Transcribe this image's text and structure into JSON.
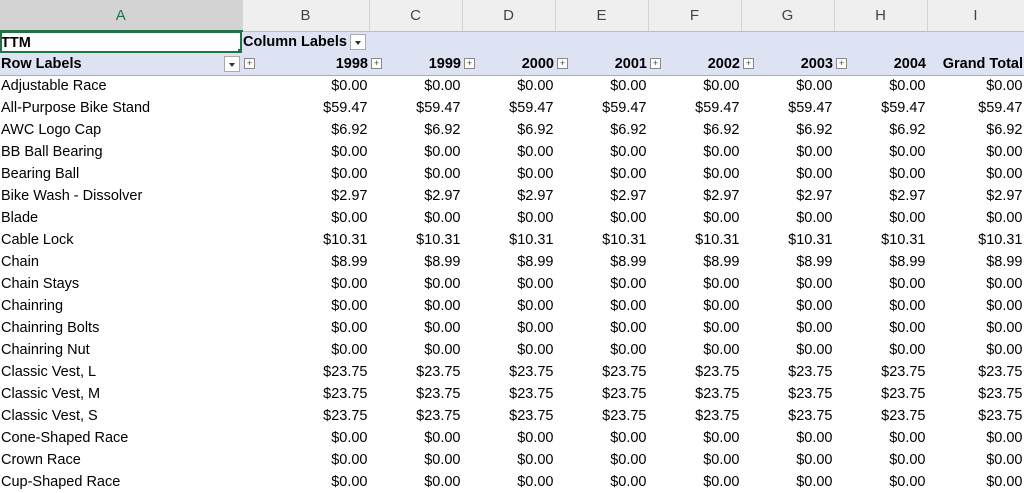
{
  "sheet": {
    "columns": [
      "A",
      "B",
      "C",
      "D",
      "E",
      "F",
      "G",
      "H",
      "I"
    ],
    "pivot": {
      "filter_label": "TTM",
      "column_labels": "Column Labels",
      "row_labels": "Row Labels",
      "years": [
        "1998",
        "1999",
        "2000",
        "2001",
        "2002",
        "2003",
        "2004"
      ],
      "grand_total": "Grand Total"
    },
    "rows": [
      {
        "label": "Adjustable Race",
        "values": [
          "$0.00",
          "$0.00",
          "$0.00",
          "$0.00",
          "$0.00",
          "$0.00",
          "$0.00",
          "$0.00"
        ]
      },
      {
        "label": "All-Purpose Bike Stand",
        "values": [
          "$59.47",
          "$59.47",
          "$59.47",
          "$59.47",
          "$59.47",
          "$59.47",
          "$59.47",
          "$59.47"
        ]
      },
      {
        "label": "AWC Logo Cap",
        "values": [
          "$6.92",
          "$6.92",
          "$6.92",
          "$6.92",
          "$6.92",
          "$6.92",
          "$6.92",
          "$6.92"
        ]
      },
      {
        "label": "BB Ball Bearing",
        "values": [
          "$0.00",
          "$0.00",
          "$0.00",
          "$0.00",
          "$0.00",
          "$0.00",
          "$0.00",
          "$0.00"
        ]
      },
      {
        "label": "Bearing Ball",
        "values": [
          "$0.00",
          "$0.00",
          "$0.00",
          "$0.00",
          "$0.00",
          "$0.00",
          "$0.00",
          "$0.00"
        ]
      },
      {
        "label": "Bike Wash - Dissolver",
        "values": [
          "$2.97",
          "$2.97",
          "$2.97",
          "$2.97",
          "$2.97",
          "$2.97",
          "$2.97",
          "$2.97"
        ]
      },
      {
        "label": "Blade",
        "values": [
          "$0.00",
          "$0.00",
          "$0.00",
          "$0.00",
          "$0.00",
          "$0.00",
          "$0.00",
          "$0.00"
        ]
      },
      {
        "label": "Cable Lock",
        "values": [
          "$10.31",
          "$10.31",
          "$10.31",
          "$10.31",
          "$10.31",
          "$10.31",
          "$10.31",
          "$10.31"
        ]
      },
      {
        "label": "Chain",
        "values": [
          "$8.99",
          "$8.99",
          "$8.99",
          "$8.99",
          "$8.99",
          "$8.99",
          "$8.99",
          "$8.99"
        ]
      },
      {
        "label": "Chain Stays",
        "values": [
          "$0.00",
          "$0.00",
          "$0.00",
          "$0.00",
          "$0.00",
          "$0.00",
          "$0.00",
          "$0.00"
        ]
      },
      {
        "label": "Chainring",
        "values": [
          "$0.00",
          "$0.00",
          "$0.00",
          "$0.00",
          "$0.00",
          "$0.00",
          "$0.00",
          "$0.00"
        ]
      },
      {
        "label": "Chainring Bolts",
        "values": [
          "$0.00",
          "$0.00",
          "$0.00",
          "$0.00",
          "$0.00",
          "$0.00",
          "$0.00",
          "$0.00"
        ]
      },
      {
        "label": "Chainring Nut",
        "values": [
          "$0.00",
          "$0.00",
          "$0.00",
          "$0.00",
          "$0.00",
          "$0.00",
          "$0.00",
          "$0.00"
        ]
      },
      {
        "label": "Classic Vest, L",
        "values": [
          "$23.75",
          "$23.75",
          "$23.75",
          "$23.75",
          "$23.75",
          "$23.75",
          "$23.75",
          "$23.75"
        ]
      },
      {
        "label": "Classic Vest, M",
        "values": [
          "$23.75",
          "$23.75",
          "$23.75",
          "$23.75",
          "$23.75",
          "$23.75",
          "$23.75",
          "$23.75"
        ]
      },
      {
        "label": "Classic Vest, S",
        "values": [
          "$23.75",
          "$23.75",
          "$23.75",
          "$23.75",
          "$23.75",
          "$23.75",
          "$23.75",
          "$23.75"
        ]
      },
      {
        "label": "Cone-Shaped Race",
        "values": [
          "$0.00",
          "$0.00",
          "$0.00",
          "$0.00",
          "$0.00",
          "$0.00",
          "$0.00",
          "$0.00"
        ]
      },
      {
        "label": "Crown Race",
        "values": [
          "$0.00",
          "$0.00",
          "$0.00",
          "$0.00",
          "$0.00",
          "$0.00",
          "$0.00",
          "$0.00"
        ]
      },
      {
        "label": "Cup-Shaped Race",
        "values": [
          "$0.00",
          "$0.00",
          "$0.00",
          "$0.00",
          "$0.00",
          "$0.00",
          "$0.00",
          "$0.00"
        ]
      }
    ]
  }
}
